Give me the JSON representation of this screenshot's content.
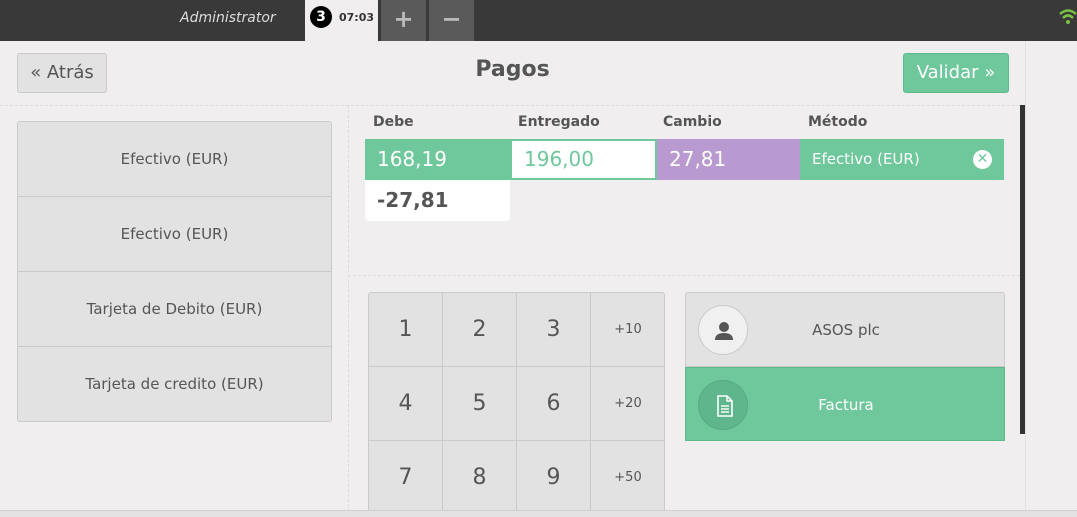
{
  "topbar": {
    "user": "Administrator",
    "order_number": "3",
    "order_time": "07:03",
    "add_label": "+",
    "remove_label": "−"
  },
  "header": {
    "back_label": "« Atrás",
    "title": "Pagos",
    "validate_label": "Validar »"
  },
  "payment_methods": [
    "Efectivo (EUR)",
    "Efectivo (EUR)",
    "Tarjeta de Debito (EUR)",
    "Tarjeta de credito (EUR)"
  ],
  "paymentlines": {
    "headers": {
      "due": "Debe",
      "tendered": "Entregado",
      "change": "Cambio",
      "method": "Método"
    },
    "line": {
      "due": "168,19",
      "tendered": "196,00",
      "change": "27,81",
      "method": "Efectivo (EUR)"
    },
    "remaining": "-27,81"
  },
  "numpad": {
    "keys": [
      "1",
      "2",
      "3",
      "+10",
      "4",
      "5",
      "6",
      "+20",
      "7",
      "8",
      "9",
      "+50"
    ]
  },
  "customer": {
    "name": "ASOS plc",
    "icon": "user-icon"
  },
  "invoice": {
    "label": "Factura",
    "icon": "document-icon"
  },
  "colors": {
    "accent": "#6ec89b",
    "change": "#b99ad0",
    "topbar": "#393939"
  }
}
